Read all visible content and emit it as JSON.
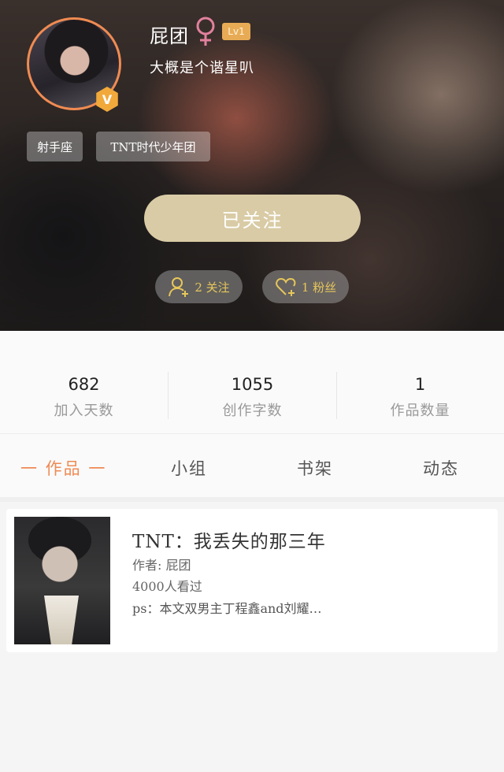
{
  "profile": {
    "username": "屁团",
    "level": "Lv1",
    "bio": "大概是个谐星叭",
    "verified_badge": "V",
    "tags": [
      "射手座",
      "TNT时代少年团"
    ],
    "follow_button": "已关注",
    "following_label": "2 关注",
    "fans_label": "1 粉丝"
  },
  "stats": [
    {
      "value": "682",
      "label": "加入天数"
    },
    {
      "value": "1055",
      "label": "创作字数"
    },
    {
      "value": "1",
      "label": "作品数量"
    }
  ],
  "tabs": [
    {
      "label": "一 作品 一"
    },
    {
      "label": "小组"
    },
    {
      "label": "书架"
    },
    {
      "label": "动态"
    }
  ],
  "works": [
    {
      "title": "TNT：我丢失的那三年",
      "author": "作者: 屁团",
      "views": "4000人看过",
      "summary": "ps：本文双男主丁程鑫and刘耀…"
    }
  ],
  "colors": {
    "accent": "#ef8a55",
    "avatar_ring": "#f08b52",
    "follow_button": "#d9cba5",
    "gender_icon": "#e2819d",
    "pill_text": "#e7c65a"
  },
  "icons": {
    "gender": "female-icon",
    "following": "user-add-icon",
    "fans": "heart-add-icon"
  }
}
